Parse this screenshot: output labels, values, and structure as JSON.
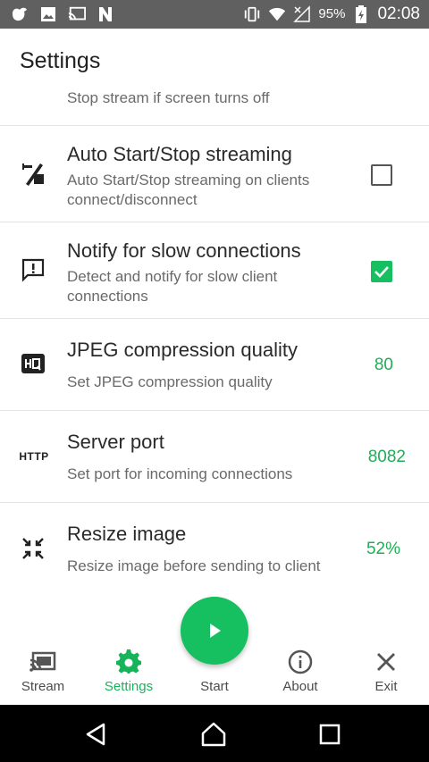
{
  "status_bar": {
    "battery_percent": "95%",
    "time": "02:08"
  },
  "app_bar": {
    "title": "Settings"
  },
  "settings": [
    {
      "id": "stop-on-screen-off",
      "subtitle": "Stop stream if screen turns off"
    },
    {
      "id": "auto-start-stop",
      "icon": "auto-start-stop-icon",
      "title": "Auto Start/Stop streaming",
      "subtitle": "Auto Start/Stop streaming on clients connect/disconnect",
      "control": "checkbox",
      "checked": false
    },
    {
      "id": "notify-slow",
      "icon": "feedback-icon",
      "title": "Notify for slow connections",
      "subtitle": "Detect and notify for slow client connections",
      "control": "checkbox",
      "checked": true
    },
    {
      "id": "jpeg-quality",
      "icon": "hq-icon",
      "title": "JPEG compression quality",
      "subtitle": "Set JPEG compression quality",
      "value": "80"
    },
    {
      "id": "server-port",
      "icon": "http-icon",
      "icon_text": "HTTP",
      "title": "Server port",
      "subtitle": "Set port for incoming connections",
      "value": "8082"
    },
    {
      "id": "resize-image",
      "icon": "resize-icon",
      "title": "Resize image",
      "subtitle": "Resize image before sending to client",
      "value": "52%"
    }
  ],
  "bottom_nav": [
    {
      "label": "Stream",
      "icon": "cast-icon",
      "active": false
    },
    {
      "label": "Settings",
      "icon": "gear-icon",
      "active": true
    },
    {
      "label": "Start",
      "icon": "play-icon",
      "active": false
    },
    {
      "label": "About",
      "icon": "info-icon",
      "active": false
    },
    {
      "label": "Exit",
      "icon": "close-icon",
      "active": false
    }
  ],
  "colors": {
    "accent": "#16c060",
    "accent_text": "#1fae57",
    "status_bar": "#606060",
    "nav_bar": "#000000"
  }
}
